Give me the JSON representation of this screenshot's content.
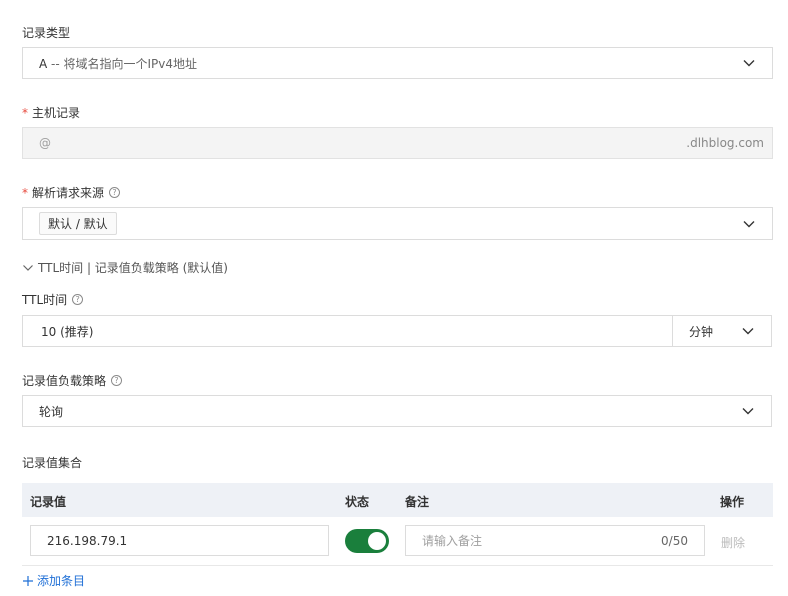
{
  "record_type": {
    "label": "记录类型",
    "value_prefix": "A",
    "value_desc": " -- 将域名指向一个IPv4地址"
  },
  "host_record": {
    "label": "主机记录",
    "required_mark": "*",
    "value": "@",
    "suffix": ".dlhblog.com"
  },
  "resolve_source": {
    "label": "解析请求来源",
    "required_mark": "*",
    "tag": "默认 / 默认"
  },
  "advanced_toggle": {
    "label": "TTL时间 | 记录值负载策略 (默认值)"
  },
  "ttl": {
    "label": "TTL时间",
    "value": "10 (推荐)",
    "unit": "分钟"
  },
  "load_strategy": {
    "label": "记录值负载策略",
    "value": "轮询"
  },
  "record_set": {
    "title": "记录值集合",
    "columns": {
      "value": "记录值",
      "status": "状态",
      "remark": "备注",
      "action": "操作"
    },
    "rows": [
      {
        "value": "216.198.79.1",
        "status_on": true,
        "remark_placeholder": "请输入备注",
        "remark_count": "0/50",
        "delete_label": "删除"
      }
    ],
    "add_label": "添加条目"
  },
  "help_glyph": "?",
  "colors": {
    "toggle_on": "#1a7f3c",
    "link": "#1f6fd6",
    "required": "#e84a3e",
    "table_header_bg": "#eef1f6"
  }
}
